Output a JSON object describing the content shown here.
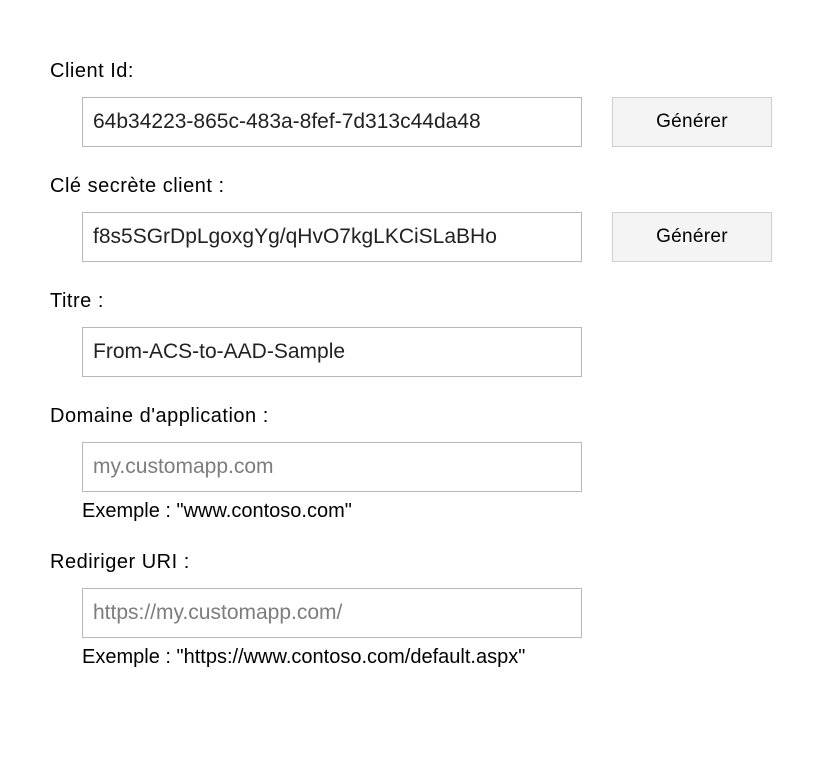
{
  "fields": {
    "clientId": {
      "label": "Client   Id:",
      "value": "64b34223-865c-483a-8fef-7d313c44da48",
      "button": "Générer"
    },
    "clientSecret": {
      "label": "Clé secrète client :",
      "value": "f8s5SGrDpLgoxgYg/qHvO7kgLKCiSLaBHo",
      "button": "Générer"
    },
    "title": {
      "label": "Titre :",
      "value": "From-ACS-to-AAD-Sample"
    },
    "appDomain": {
      "label": "Domaine d'application :",
      "value": "my.customapp.com",
      "hint": "Exemple : \"www.contoso.com\""
    },
    "redirectUri": {
      "label": "Rediriger   URI :",
      "value": "https://my.customapp.com/",
      "hint": "Exemple : \"https://www.contoso.com/default.aspx\""
    }
  }
}
